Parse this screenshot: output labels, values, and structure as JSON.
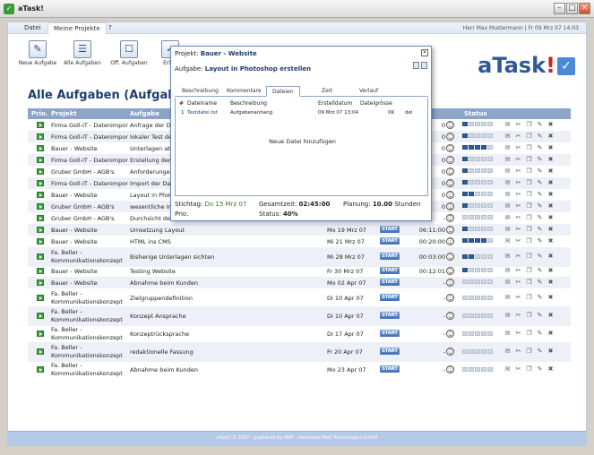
{
  "window": {
    "title": "aTask!"
  },
  "menu": {
    "items": [
      "Datei",
      "Meine Projekte",
      "?"
    ],
    "user": "Herr Max Mustermann",
    "date": "Fr 09 Mrz 07 14:03"
  },
  "toolbar": {
    "items": [
      "Neue Aufgabe",
      "Alle Aufgaben",
      "Off. Aufgaben",
      "Erl. A"
    ]
  },
  "logo": {
    "text": "aTask",
    "excl": "!"
  },
  "page": {
    "title": "Alle Aufgaben (Aufgaben a"
  },
  "grid": {
    "headers": {
      "prio": "Prio.",
      "projekt": "Projekt",
      "aufgabe": "Aufgabe",
      "status": "Status"
    },
    "start_label": "START",
    "rows": [
      {
        "projekt": "Firma Goll-IT - Datenimport",
        "aufgabe": "Anfrage der Da",
        "datum": "",
        "zeit": "0",
        "status": 1
      },
      {
        "projekt": "Firma Goll-IT - Datenimport",
        "aufgabe": "lokaler Test de",
        "datum": "",
        "zeit": "0",
        "status": 1
      },
      {
        "projekt": "Bauer - Website",
        "aufgabe": "Unterlagen ab",
        "datum": "",
        "zeit": "0",
        "status": 4
      },
      {
        "projekt": "Firma Goll-IT - Datenimport",
        "aufgabe": "Erstellung der",
        "datum": "",
        "zeit": "0",
        "status": 1
      },
      {
        "projekt": "Gruber GmbH - AGB's",
        "aufgabe": "Anforderunger",
        "datum": "",
        "zeit": "0",
        "status": 1
      },
      {
        "projekt": "Firma Goll-IT - Datenimport",
        "aufgabe": "Import der Da",
        "datum": "",
        "zeit": "0",
        "status": 1
      },
      {
        "projekt": "Bauer - Website",
        "aufgabe": "Layout in Phot",
        "datum": "",
        "zeit": "0",
        "status": 2
      },
      {
        "projekt": "Gruber GmbH - AGB's",
        "aufgabe": "wesentliche In",
        "datum": "",
        "zeit": "0",
        "status": 1
      },
      {
        "projekt": "Gruber GmbH - AGB's",
        "aufgabe": "Durchsicht der",
        "datum": "",
        "zeit": "-",
        "status": 0
      },
      {
        "projekt": "Bauer - Website",
        "aufgabe": "Umsetzung Layout",
        "datum": "Mo 19 Mrz 07",
        "zeit": "06:11:00",
        "status": 1
      },
      {
        "projekt": "Bauer - Website",
        "aufgabe": "HTML ins CMS",
        "datum": "Mi 21 Mrz 07",
        "zeit": "00:20:00",
        "status": 4
      },
      {
        "projekt": "Fa. Beller - Kommunikationskonzept",
        "aufgabe": "Bisherige Unterlagen sichten",
        "datum": "Mi 28 Mrz 07",
        "zeit": "00:03:00",
        "status": 2
      },
      {
        "projekt": "Bauer - Website",
        "aufgabe": "Testing Website",
        "datum": "Fr 30 Mrz 07",
        "zeit": "00:12:01",
        "status": 1
      },
      {
        "projekt": "Bauer - Website",
        "aufgabe": "Abnahme beim Kunden",
        "datum": "Mo 02 Apr 07",
        "zeit": "-",
        "status": 0
      },
      {
        "projekt": "Fa. Beller - Kommunikationskonzept",
        "aufgabe": "Zielgruppendefinition",
        "datum": "Di 10 Apr 07",
        "zeit": "-",
        "status": 0
      },
      {
        "projekt": "Fa. Beller - Kommunikationskonzept",
        "aufgabe": "Konzept Ansprache",
        "datum": "Di 10 Apr 07",
        "zeit": "-",
        "status": 0
      },
      {
        "projekt": "Fa. Beller - Kommunikationskonzept",
        "aufgabe": "Konzeptrücksprache",
        "datum": "Di 17 Apr 07",
        "zeit": "-",
        "status": 0
      },
      {
        "projekt": "Fa. Beller - Kommunikationskonzept",
        "aufgabe": "redaktionelle Fassung",
        "datum": "Fr 20 Apr 07",
        "zeit": "-",
        "status": 0
      },
      {
        "projekt": "Fa. Beller - Kommunikationskonzept",
        "aufgabe": "Abnahme beim Kunden",
        "datum": "Mo 23 Apr 07",
        "zeit": "-",
        "status": 0
      }
    ]
  },
  "modal": {
    "project_label": "Projekt:",
    "project": "Bauer - Website",
    "task_label": "Aufgabe:",
    "task": "Layout in Photoshop erstellen",
    "tabs": [
      "Beschreibung",
      "Kommentare",
      "Dateien",
      "Zeit",
      "Verlauf"
    ],
    "file_headers": [
      "#",
      "Dateiname",
      "Beschreibung",
      "Erstelldatum",
      "Dateigrösse"
    ],
    "file": {
      "nr": "1",
      "name": "Testdatei.txt",
      "desc": "Aufgabenanhang",
      "date": "09 Mrz 07 13:04",
      "size": "0K",
      "del": "del"
    },
    "add_file": "Neue Datei hinzufügen",
    "stichtag_label": "Stichtag:",
    "stichtag": "Do 15 Mrz 07",
    "gesamtzeit_label": "Gesamtzeit:",
    "gesamtzeit": "02:45:00",
    "planung_label": "Planung:",
    "planung": "10.00",
    "planung_unit": "Stunden",
    "prio_label": "Prio.",
    "status_label": "Status:",
    "status": "40%"
  },
  "footer": {
    "text": "aTask! © 2007 - published by AWT - Advanced Web Technologies GmbH"
  }
}
